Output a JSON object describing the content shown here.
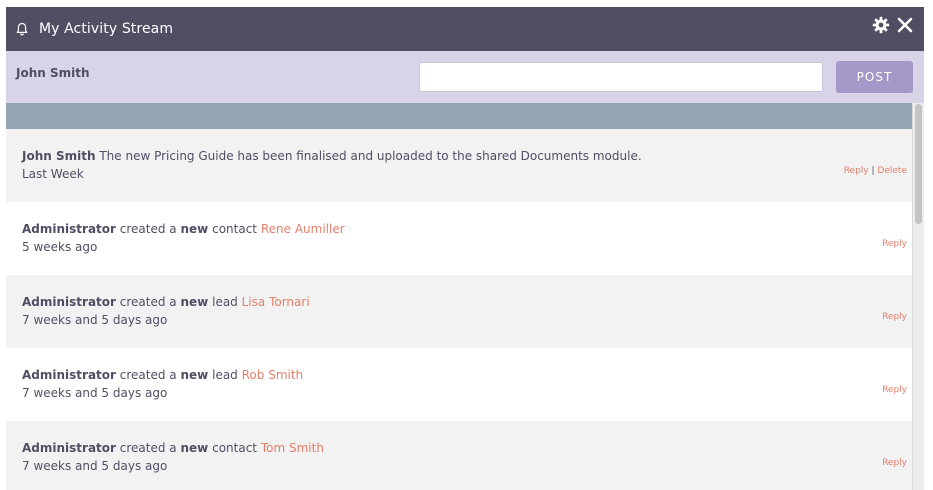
{
  "header": {
    "title": "My Activity Stream",
    "icons": {
      "left": "bell-icon",
      "settings": "gear-icon",
      "close": "close-icon"
    }
  },
  "post_bar": {
    "user": "John Smith",
    "input_value": "",
    "button_label": "POST"
  },
  "entries": [
    {
      "actor": "John Smith",
      "text": "The new Pricing Guide has been finalised and uploaded to the shared Documents module.",
      "time": "Last Week",
      "reply": "Reply",
      "separator": "|",
      "delete": "Delete"
    },
    {
      "actor": "Administrator",
      "pre": "created a",
      "bold": "new",
      "type": "contact",
      "link": "Rene Aumiller",
      "time": "5 weeks ago",
      "reply": "Reply"
    },
    {
      "actor": "Administrator",
      "pre": "created a",
      "bold": "new",
      "type": "lead",
      "link": "Lisa Tornari",
      "time": "7 weeks and 5 days ago",
      "reply": "Reply"
    },
    {
      "actor": "Administrator",
      "pre": "created a",
      "bold": "new",
      "type": "lead",
      "link": "Rob Smith",
      "time": "7 weeks and 5 days ago",
      "reply": "Reply"
    },
    {
      "actor": "Administrator",
      "pre": "created a",
      "bold": "new",
      "type": "contact",
      "link": "Tom Smith",
      "time": "7 weeks and 5 days ago",
      "reply": "Reply"
    }
  ],
  "colors": {
    "header_bg": "#534d64",
    "post_bar_bg": "#d8d3e6",
    "button_bg": "#a597c7",
    "stream_top_bg": "#94a4b1",
    "link": "#e3806a"
  }
}
